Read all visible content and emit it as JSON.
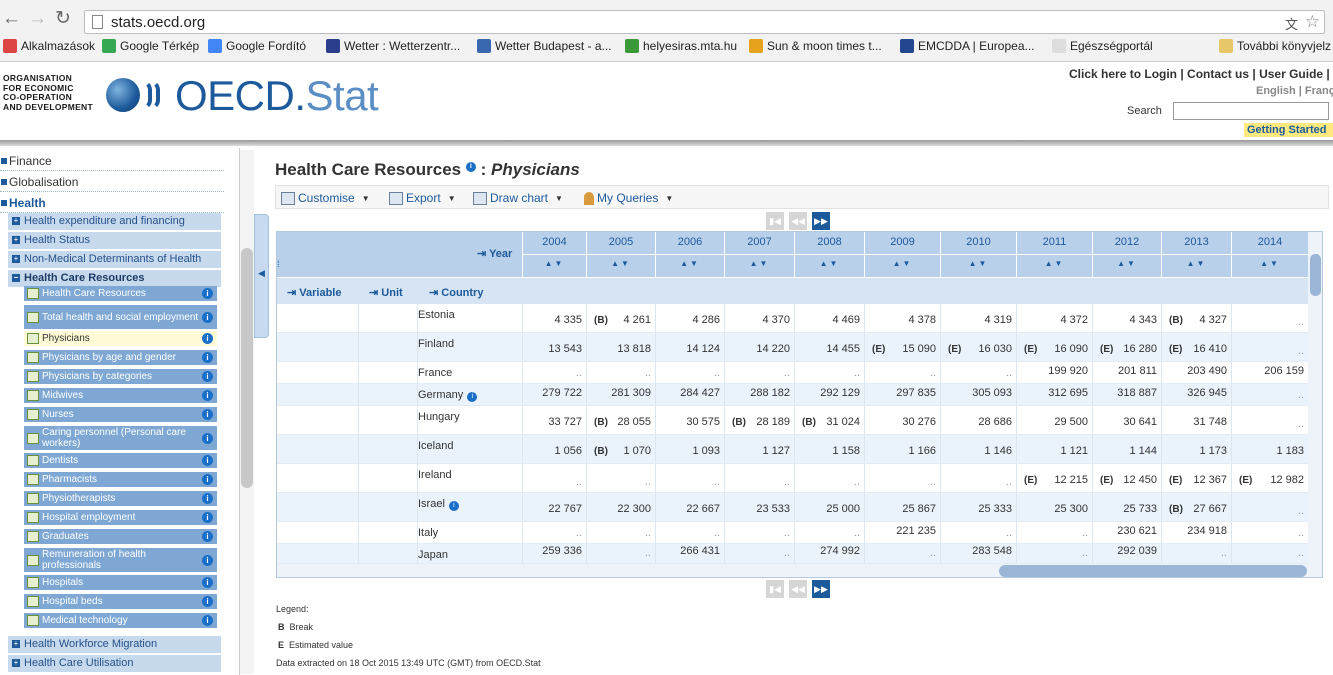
{
  "browser": {
    "url": "stats.oecd.org",
    "bookmarks": [
      {
        "label": "Alkalmazások",
        "icon": "apps-grid-icon",
        "color": "#d44"
      },
      {
        "label": "Google Térkép",
        "icon": "maps-icon",
        "color": "#34a853"
      },
      {
        "label": "Google Fordító",
        "icon": "translate-icon",
        "color": "#4285f4"
      },
      {
        "label": "Wetter : Wetterzentr...",
        "icon": "weather-icon",
        "color": "#2b3e8c"
      },
      {
        "label": "Wetter Budapest - a...",
        "icon": "globe-icon",
        "color": "#3a68b0"
      },
      {
        "label": "helyesiras.mta.hu",
        "icon": "checkmark-icon",
        "color": "#3a9a3a"
      },
      {
        "label": "Sun & moon times t...",
        "icon": "sun-icon",
        "color": "#e6a21a"
      },
      {
        "label": "EMCDDA | Europea...",
        "icon": "emcdda-icon",
        "color": "#23478f"
      },
      {
        "label": "Egészségportál",
        "icon": "page-icon",
        "color": "#dddddd"
      },
      {
        "label": "További könyvjelz",
        "icon": "folder-icon",
        "color": "#e8c76a"
      }
    ]
  },
  "header": {
    "org_lines": [
      "ORGANISATION",
      "FOR ECONOMIC",
      "CO-OPERATION",
      "AND DEVELOPMENT"
    ],
    "brand_main": "OECD.",
    "brand_sub": "Stat",
    "top_links": "Click here to Login | Contact us |  User Guide |  Ho",
    "lang_links": "English | Franç",
    "search_label": "Search",
    "getting_started": "Getting Started"
  },
  "sidebar": {
    "top_items": [
      "Finance",
      "Globalisation",
      "Health"
    ],
    "level1": [
      "Health expenditure and financing",
      "Health Status",
      "Non-Medical Determinants of Health",
      "Health Care Resources"
    ],
    "level2": [
      "Health Care Resources",
      "Total health and social employment",
      "Physicians",
      "Physicians by age and gender",
      "Physicians by categories",
      "Midwives",
      "Nurses",
      "Caring personnel (Personal care workers)",
      "Dentists",
      "Pharmacists",
      "Physiotherapists",
      "Hospital employment",
      "Graduates",
      "Remuneration of health professionals",
      "Hospitals",
      "Hospital beds",
      "Medical technology"
    ],
    "level1_bottom": [
      "Health Workforce Migration",
      "Health Care Utilisation"
    ],
    "selected": "Physicians"
  },
  "main": {
    "title_prefix": "Health Care Resources",
    "title_sep": ":",
    "title_suffix": "Physicians",
    "toolbar": [
      "Customise",
      "Export",
      "Draw chart",
      "My Queries"
    ],
    "year_label": "Year",
    "dims": [
      "Variable",
      "Unit",
      "Country"
    ],
    "years": [
      "2004",
      "2005",
      "2006",
      "2007",
      "2008",
      "2009",
      "2010",
      "2011",
      "2012",
      "2013",
      "2014"
    ],
    "rows": [
      {
        "country": "Estonia",
        "info": false,
        "cells": [
          [
            "",
            "4 335"
          ],
          [
            "B",
            "4 261"
          ],
          [
            "",
            "4 286"
          ],
          [
            "",
            "4 370"
          ],
          [
            "",
            "4 469"
          ],
          [
            "",
            "4 378"
          ],
          [
            "",
            "4 319"
          ],
          [
            "",
            "4 372"
          ],
          [
            "",
            "4 343"
          ],
          [
            "B",
            "4 327"
          ],
          [
            "",
            ".."
          ]
        ]
      },
      {
        "country": "Finland",
        "info": false,
        "cells": [
          [
            "",
            "13 543"
          ],
          [
            "",
            "13 818"
          ],
          [
            "",
            "14 124"
          ],
          [
            "",
            "14 220"
          ],
          [
            "",
            "14 455"
          ],
          [
            "E",
            "15 090"
          ],
          [
            "E",
            "16 030"
          ],
          [
            "E",
            "16 090"
          ],
          [
            "E",
            "16 280"
          ],
          [
            "E",
            "16 410"
          ],
          [
            "",
            ".."
          ]
        ]
      },
      {
        "country": "France",
        "info": false,
        "cells": [
          [
            "",
            ".."
          ],
          [
            "",
            ".."
          ],
          [
            "",
            ".."
          ],
          [
            "",
            ".."
          ],
          [
            "",
            ".."
          ],
          [
            "",
            ".."
          ],
          [
            "",
            ".."
          ],
          [
            "",
            "199 920"
          ],
          [
            "",
            "201 811"
          ],
          [
            "",
            "203 490"
          ],
          [
            "",
            "206 159"
          ]
        ]
      },
      {
        "country": "Germany",
        "info": true,
        "cells": [
          [
            "",
            "279 722"
          ],
          [
            "",
            "281 309"
          ],
          [
            "",
            "284 427"
          ],
          [
            "",
            "288 182"
          ],
          [
            "",
            "292 129"
          ],
          [
            "",
            "297 835"
          ],
          [
            "",
            "305 093"
          ],
          [
            "",
            "312 695"
          ],
          [
            "",
            "318 887"
          ],
          [
            "",
            "326 945"
          ],
          [
            "",
            ".."
          ]
        ]
      },
      {
        "country": "Hungary",
        "info": false,
        "cells": [
          [
            "",
            "33 727"
          ],
          [
            "B",
            "28 055"
          ],
          [
            "",
            "30 575"
          ],
          [
            "B",
            "28 189"
          ],
          [
            "B",
            "31 024"
          ],
          [
            "",
            "30 276"
          ],
          [
            "",
            "28 686"
          ],
          [
            "",
            "29 500"
          ],
          [
            "",
            "30 641"
          ],
          [
            "",
            "31 748"
          ],
          [
            "",
            ".."
          ]
        ]
      },
      {
        "country": "Iceland",
        "info": false,
        "cells": [
          [
            "",
            "1 056"
          ],
          [
            "B",
            "1 070"
          ],
          [
            "",
            "1 093"
          ],
          [
            "",
            "1 127"
          ],
          [
            "",
            "1 158"
          ],
          [
            "",
            "1 166"
          ],
          [
            "",
            "1 146"
          ],
          [
            "",
            "1 121"
          ],
          [
            "",
            "1 144"
          ],
          [
            "",
            "1 173"
          ],
          [
            "",
            "1 183"
          ]
        ]
      },
      {
        "country": "Ireland",
        "info": false,
        "cells": [
          [
            "",
            ".."
          ],
          [
            "",
            ".."
          ],
          [
            "",
            ".."
          ],
          [
            "",
            ".."
          ],
          [
            "",
            ".."
          ],
          [
            "",
            ".."
          ],
          [
            "",
            ".."
          ],
          [
            "E",
            "12 215"
          ],
          [
            "E",
            "12 450"
          ],
          [
            "E",
            "12 367"
          ],
          [
            "E",
            "12 982"
          ]
        ]
      },
      {
        "country": "Israel",
        "info": true,
        "cells": [
          [
            "",
            "22 767"
          ],
          [
            "",
            "22 300"
          ],
          [
            "",
            "22 667"
          ],
          [
            "",
            "23 533"
          ],
          [
            "",
            "25 000"
          ],
          [
            "",
            "25 867"
          ],
          [
            "",
            "25 333"
          ],
          [
            "",
            "25 300"
          ],
          [
            "",
            "25 733"
          ],
          [
            "B",
            "27 667"
          ],
          [
            "",
            ".."
          ]
        ]
      },
      {
        "country": "Italy",
        "info": false,
        "cells": [
          [
            "",
            ".."
          ],
          [
            "",
            ".."
          ],
          [
            "",
            ".."
          ],
          [
            "",
            ".."
          ],
          [
            "",
            ".."
          ],
          [
            "",
            "221 235"
          ],
          [
            "",
            ".."
          ],
          [
            "",
            ".."
          ],
          [
            "",
            "230 621"
          ],
          [
            "",
            "234 918"
          ],
          [
            "",
            ".."
          ]
        ]
      },
      {
        "country": "Japan",
        "info": false,
        "cells": [
          [
            "",
            "259 336"
          ],
          [
            "",
            ".."
          ],
          [
            "",
            "266 431"
          ],
          [
            "",
            ".."
          ],
          [
            "",
            "274 992"
          ],
          [
            "",
            ".."
          ],
          [
            "",
            "283 548"
          ],
          [
            "",
            ".."
          ],
          [
            "",
            "292 039"
          ],
          [
            "",
            ".."
          ],
          [
            "",
            ".."
          ]
        ]
      }
    ]
  },
  "legend": {
    "title": "Legend:",
    "items": [
      {
        "code": "B",
        "text": "Break"
      },
      {
        "code": "E",
        "text": "Estimated value"
      }
    ],
    "footer": "Data extracted on 18 Oct 2015 13:49 UTC (GMT) from OECD.Stat"
  }
}
